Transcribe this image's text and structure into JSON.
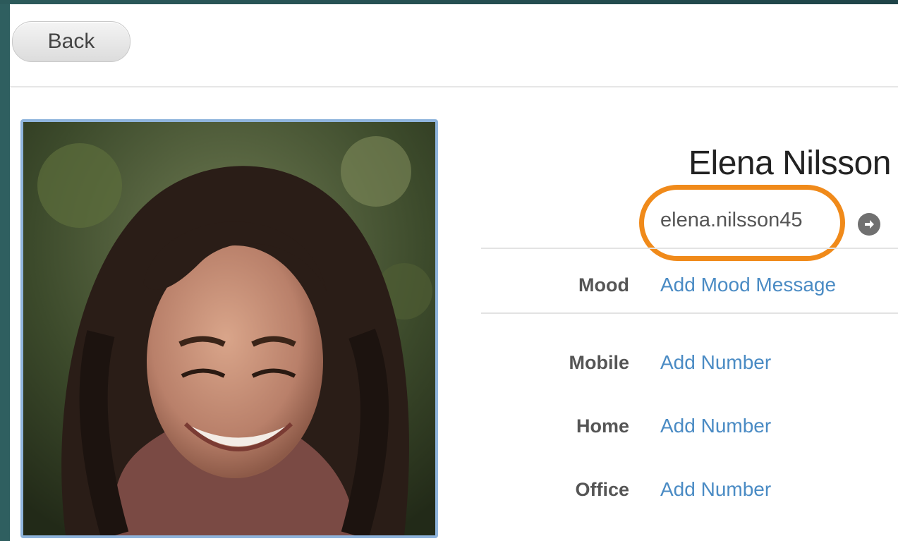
{
  "toolbar": {
    "back_label": "Back"
  },
  "contact": {
    "name": "Elena Nilsson",
    "username": "elena.nilsson45"
  },
  "fields": {
    "mood": {
      "label": "Mood",
      "value": "Add Mood Message"
    },
    "mobile": {
      "label": "Mobile",
      "value": "Add Number"
    },
    "home": {
      "label": "Home",
      "value": "Add Number"
    },
    "office": {
      "label": "Office",
      "value": "Add Number"
    }
  },
  "icons": {
    "profile_arrow": "arrow-right-circle-icon"
  },
  "colors": {
    "highlight": "#f08a1a",
    "link": "#4a8bc4",
    "avatar_border": "#8fb4dc",
    "background_edge": "#2f5f60"
  }
}
